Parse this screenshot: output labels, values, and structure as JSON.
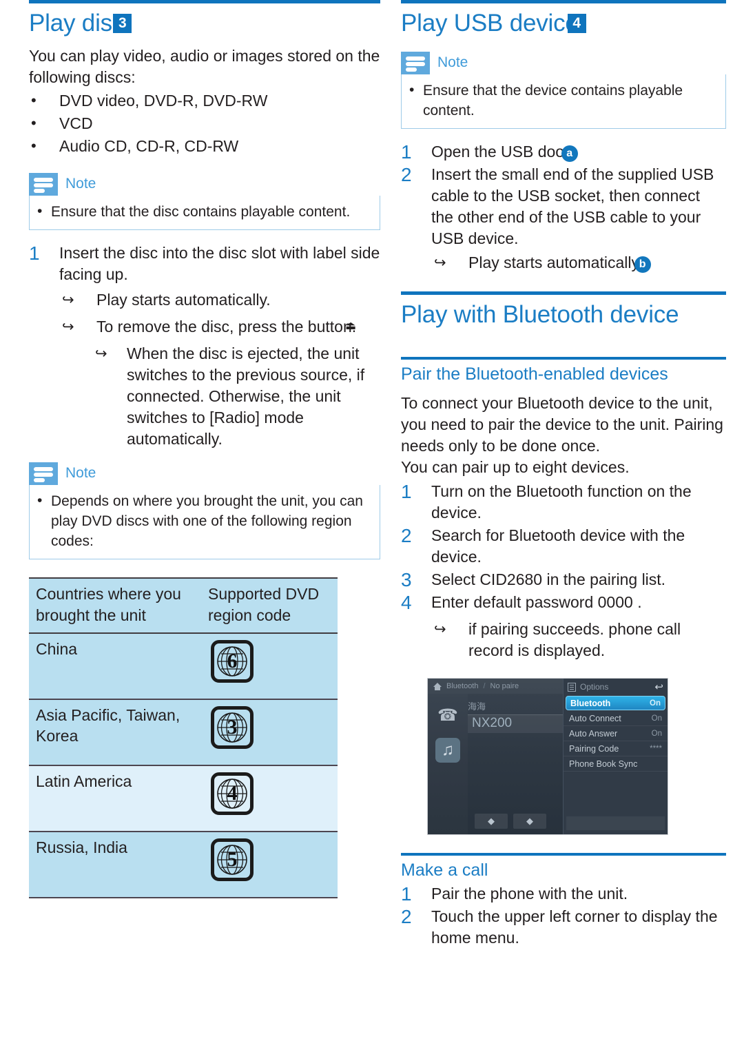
{
  "left": {
    "heading": {
      "text": "Play disc",
      "badge": "3"
    },
    "intro": "You can play video, audio or images stored on the following discs:",
    "disc_types": [
      "DVD video, DVD-R, DVD-RW",
      "VCD",
      "Audio CD, CD-R, CD-RW"
    ],
    "note1": {
      "label": "Note",
      "items": [
        "Ensure that the disc contains playable content."
      ]
    },
    "step1": {
      "num": "1",
      "text": "Insert the disc into the disc slot with label side facing up.",
      "sub": [
        "Play starts automatically.",
        "To remove the disc, press the  button."
      ],
      "subsub": "When the disc is ejected, the unit switches to the previous source, if connected. Otherwise, the unit switches to [Radio] mode automatically."
    },
    "note2": {
      "label": "Note",
      "items": [
        "Depends on where you brought the unit, you can play DVD discs with one of the following region codes:"
      ]
    },
    "table": {
      "headers": [
        "Countries where you brought the unit",
        "Supported DVD region code"
      ],
      "rows": [
        {
          "country": "China",
          "code": "6"
        },
        {
          "country": "Asia Pacific, Taiwan, Korea",
          "code": "3"
        },
        {
          "country": "Latin America",
          "code": "4"
        },
        {
          "country": "Russia, India",
          "code": "5"
        }
      ]
    }
  },
  "right": {
    "usb": {
      "heading": {
        "text": "Play USB device",
        "badge": "4"
      },
      "note": {
        "label": "Note",
        "items": [
          "Ensure that the device contains playable content."
        ]
      },
      "steps": [
        {
          "num": "1",
          "text": "Open the USB door",
          "marker": "a"
        },
        {
          "num": "2",
          "text": "Insert the small end of the supplied USB cable to the USB socket, then connect the other end of the USB cable to your USB device."
        }
      ],
      "sub": {
        "text": "Play starts automatically.",
        "marker": "b"
      }
    },
    "bluetooth": {
      "heading": "Play with Bluetooth device",
      "pair": {
        "heading": "Pair the Bluetooth-enabled devices",
        "intro1": "To connect your Bluetooth device to the unit, you need to pair the device to the unit. Pairing needs only to be done once.",
        "intro2": "You can pair up to eight devices.",
        "steps": [
          {
            "num": "1",
            "text": "Turn on the Bluetooth function on the device."
          },
          {
            "num": "2",
            "text": "Search for Bluetooth device with the device."
          },
          {
            "num": "3",
            "text": "Select  CID2680  in the pairing list."
          },
          {
            "num": "4",
            "text": "Enter default password  0000 ."
          }
        ],
        "sub": "if pairing succeeds. phone call record is displayed."
      },
      "screenshot": {
        "breadcrumb": {
          "root": "Bluetooth",
          "sep": "/",
          "state": "No paire"
        },
        "side_icons": [
          "phone-icon",
          "music-icon"
        ],
        "device_cn_name": "海海",
        "device_name": "NX200",
        "nav_up": "◆",
        "nav_down": "◆",
        "options": {
          "title": "Options",
          "back": "↩",
          "rows": [
            {
              "label": "Bluetooth",
              "value": "On",
              "selected": true
            },
            {
              "label": "Auto Connect",
              "value": "On",
              "selected": false
            },
            {
              "label": "Auto Answer",
              "value": "On",
              "selected": false
            },
            {
              "label": "Pairing Code",
              "value": "****",
              "selected": false
            },
            {
              "label": "Phone Book Sync",
              "value": "",
              "selected": false
            }
          ]
        }
      }
    },
    "call": {
      "heading": "Make a call",
      "steps": [
        {
          "num": "1",
          "text": "Pair the phone with the unit."
        },
        {
          "num": "2",
          "text": "Touch the upper left corner to display the home menu."
        }
      ]
    }
  },
  "colors": {
    "heading_blue": "#1b7dc4",
    "rule_blue": "#0f74bd",
    "note_icon_blue": "#5fa9dd",
    "table_header_blue": "#b9dff0",
    "table_row_light": "#dff0fa"
  }
}
